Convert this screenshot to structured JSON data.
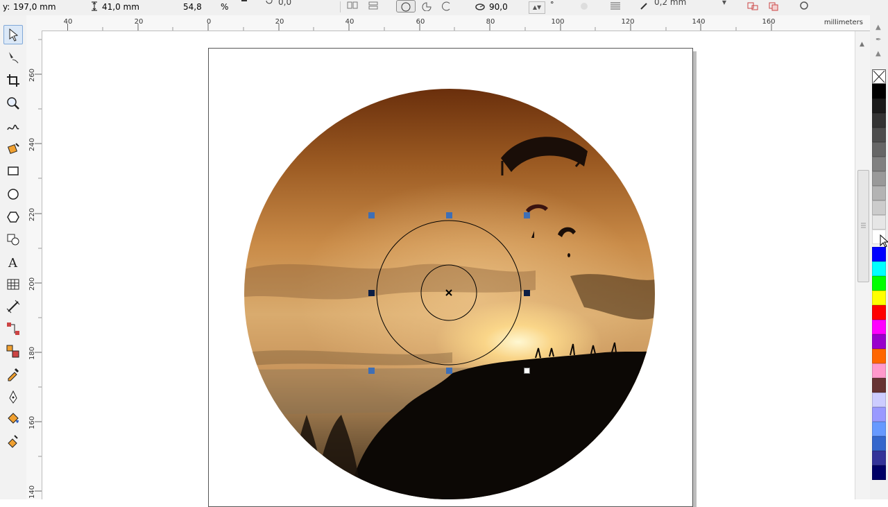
{
  "property_bar": {
    "y_label": "y:",
    "y_value": "197,0 mm",
    "height_value": "41,0 mm",
    "scale_value": "54,8",
    "scale_unit": "%",
    "rotation_value": "0,0",
    "angle_value": "90,0",
    "angle_unit": "°",
    "outline_width_value": "0,2 mm"
  },
  "ruler": {
    "units": "millimeters",
    "top_labels": [
      "40",
      "20",
      "0",
      "20",
      "40",
      "60",
      "80",
      "100",
      "120",
      "140",
      "160"
    ],
    "left_labels": [
      "260",
      "240",
      "220",
      "200",
      "180",
      "160",
      "140"
    ]
  },
  "toolbox": {
    "tools": [
      "pick-tool",
      "shape-tool",
      "crop-tool",
      "zoom-tool",
      "freehand-tool",
      "smart-fill-tool",
      "rectangle-tool",
      "ellipse-tool",
      "polygon-tool",
      "basic-shapes-tool",
      "text-tool",
      "table-tool",
      "dimension-tool",
      "connector-tool",
      "blend-tool",
      "eyedropper-tool",
      "outline-pen-tool",
      "fill-tool",
      "interactive-fill-tool"
    ]
  },
  "palette": {
    "colors": [
      "#000000",
      "#1a1a1a",
      "#333333",
      "#4d4d4d",
      "#666666",
      "#808080",
      "#999999",
      "#b3b3b3",
      "#cccccc",
      "#e6e6e6",
      "#ffffff",
      "#0000ff",
      "#00ffff",
      "#00ff00",
      "#ffff00",
      "#ff0000",
      "#ff00ff",
      "#9900cc",
      "#ff6600",
      "#ff99cc",
      "#663333",
      "#ccccff",
      "#9999ff",
      "#6699ff",
      "#3366cc",
      "#333399",
      "#000066"
    ]
  }
}
